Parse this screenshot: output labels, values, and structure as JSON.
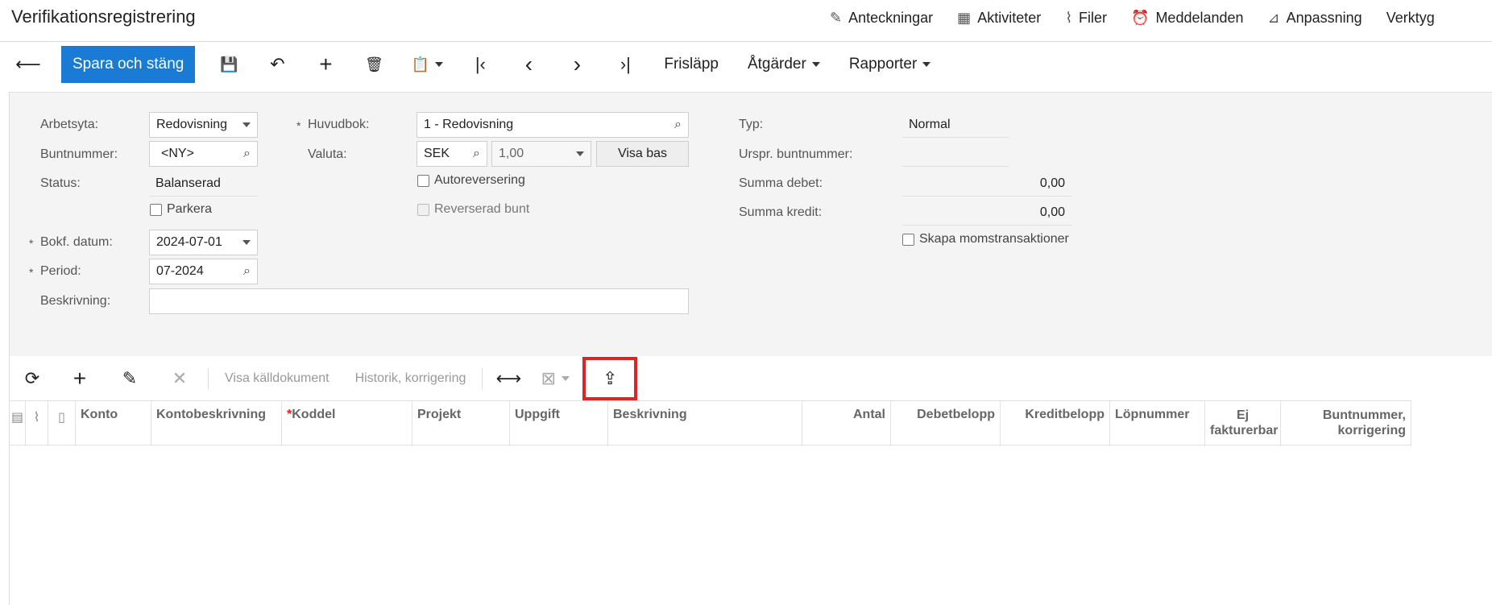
{
  "page": {
    "title": "Verifikationsregistrering"
  },
  "top_links": [
    {
      "icon": "✎",
      "label": "Anteckningar"
    },
    {
      "icon": "▦",
      "label": "Aktiviteter"
    },
    {
      "icon": "⌇",
      "label": "Filer"
    },
    {
      "icon": "⏰",
      "label": "Meddelanden"
    },
    {
      "icon": "⊿",
      "label": "Anpassning"
    },
    {
      "icon": "",
      "label": "Verktyg"
    }
  ],
  "toolbar": {
    "back_icon": "⟵",
    "save_close": "Spara och stäng",
    "save_icon": "💾",
    "undo_icon": "↶",
    "add_icon": "+",
    "delete_icon": "🗑",
    "clipboard_icon": "📋",
    "first_icon": "|‹",
    "prev_icon": "‹",
    "next_icon": "›",
    "last_icon": "›|",
    "release": "Frisläpp",
    "actions": "Åtgärder",
    "reports": "Rapporter"
  },
  "form": {
    "workspace_label": "Arbetsyta:",
    "workspace_value": "Redovisning",
    "batch_label": "Buntnummer:",
    "batch_value": "<NY>",
    "status_label": "Status:",
    "status_value": "Balanserad",
    "hold_label": "Parkera",
    "date_label": "Bokf. datum:",
    "date_value": "2024-07-01",
    "period_label": "Period:",
    "period_value": "07-2024",
    "desc_label": "Beskrivning:",
    "desc_value": "",
    "ledger_label": "Huvudbok:",
    "ledger_value": "1 - Redovisning",
    "currency_label": "Valuta:",
    "currency_value": "SEK",
    "rate_value": "1,00",
    "view_base": "Visa bas",
    "auto_reverse": "Autoreversering",
    "reversed_batch": "Reverserad bunt",
    "type_label": "Typ:",
    "type_value": "Normal",
    "orig_batch_label": "Urspr. buntnummer:",
    "orig_batch_value": "",
    "debit_total_label": "Summa debet:",
    "debit_total_value": "0,00",
    "credit_total_label": "Summa kredit:",
    "credit_total_value": "0,00",
    "create_vat": "Skapa momstransaktioner",
    "required_mark": "*"
  },
  "grid_toolbar": {
    "refresh_icon": "⟳",
    "add_icon": "+",
    "edit_icon": "✎",
    "delete_icon": "✕",
    "view_source": "Visa källdokument",
    "history": "Historik, korrigering",
    "fit_icon": "⟷",
    "excel_icon": "⊠",
    "upload_icon": "⇪"
  },
  "grid": {
    "columns": [
      {
        "label": "Konto"
      },
      {
        "label": "Kontobeskrivning"
      },
      {
        "label": "Koddel",
        "required": "*"
      },
      {
        "label": "Projekt"
      },
      {
        "label": "Uppgift"
      },
      {
        "label": "Beskrivning"
      },
      {
        "label": "Antal"
      },
      {
        "label": "Debetbelopp"
      },
      {
        "label": "Kreditbelopp"
      },
      {
        "label": "Löpnummer"
      },
      {
        "label": "Ej fakturerbar"
      },
      {
        "label": "Buntnummer, korrigering"
      }
    ]
  }
}
